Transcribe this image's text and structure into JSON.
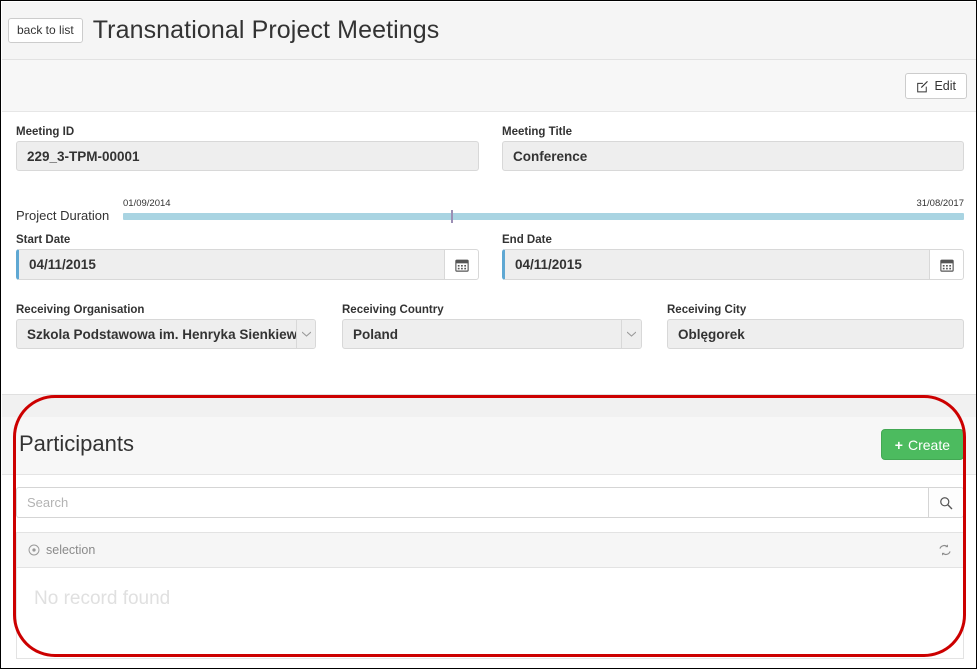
{
  "header": {
    "back_label": "back to list",
    "title": "Transnational Project Meetings"
  },
  "toolbar": {
    "edit_label": "Edit",
    "edit_icon": "pencil-square-icon"
  },
  "form": {
    "meeting_id": {
      "label": "Meeting ID",
      "value": "229_3-TPM-00001"
    },
    "meeting_title": {
      "label": "Meeting Title",
      "value": "Conference"
    },
    "project_duration": {
      "label": "Project Duration",
      "start": "01/09/2014",
      "end": "31/08/2017",
      "marker_percent": 39,
      "bar_color": "#a9d4e2",
      "marker_color": "#9b8fb5"
    },
    "start_date": {
      "label": "Start Date",
      "value": "04/11/2015",
      "icon": "calendar-icon"
    },
    "end_date": {
      "label": "End Date",
      "value": "04/11/2015",
      "icon": "calendar-icon"
    },
    "receiving_organisation": {
      "label": "Receiving Organisation",
      "value": "Szkola Podstawowa im. Henryka Sienkiewic"
    },
    "receiving_country": {
      "label": "Receiving Country",
      "value": "Poland"
    },
    "receiving_city": {
      "label": "Receiving City",
      "value": "Oblęgorek"
    }
  },
  "participants": {
    "title": "Participants",
    "create_label": "Create",
    "create_color": "#4cbb5f",
    "search_placeholder": "Search",
    "search_value": "",
    "search_icon": "magnifier-icon",
    "selection_label": "selection",
    "selection_icon": "circle-dot-icon",
    "refresh_icon": "refresh-icon",
    "empty_message": "No record found"
  },
  "annotation": {
    "color": "#cc0000",
    "shape": "rounded-rectangle-highlight"
  }
}
